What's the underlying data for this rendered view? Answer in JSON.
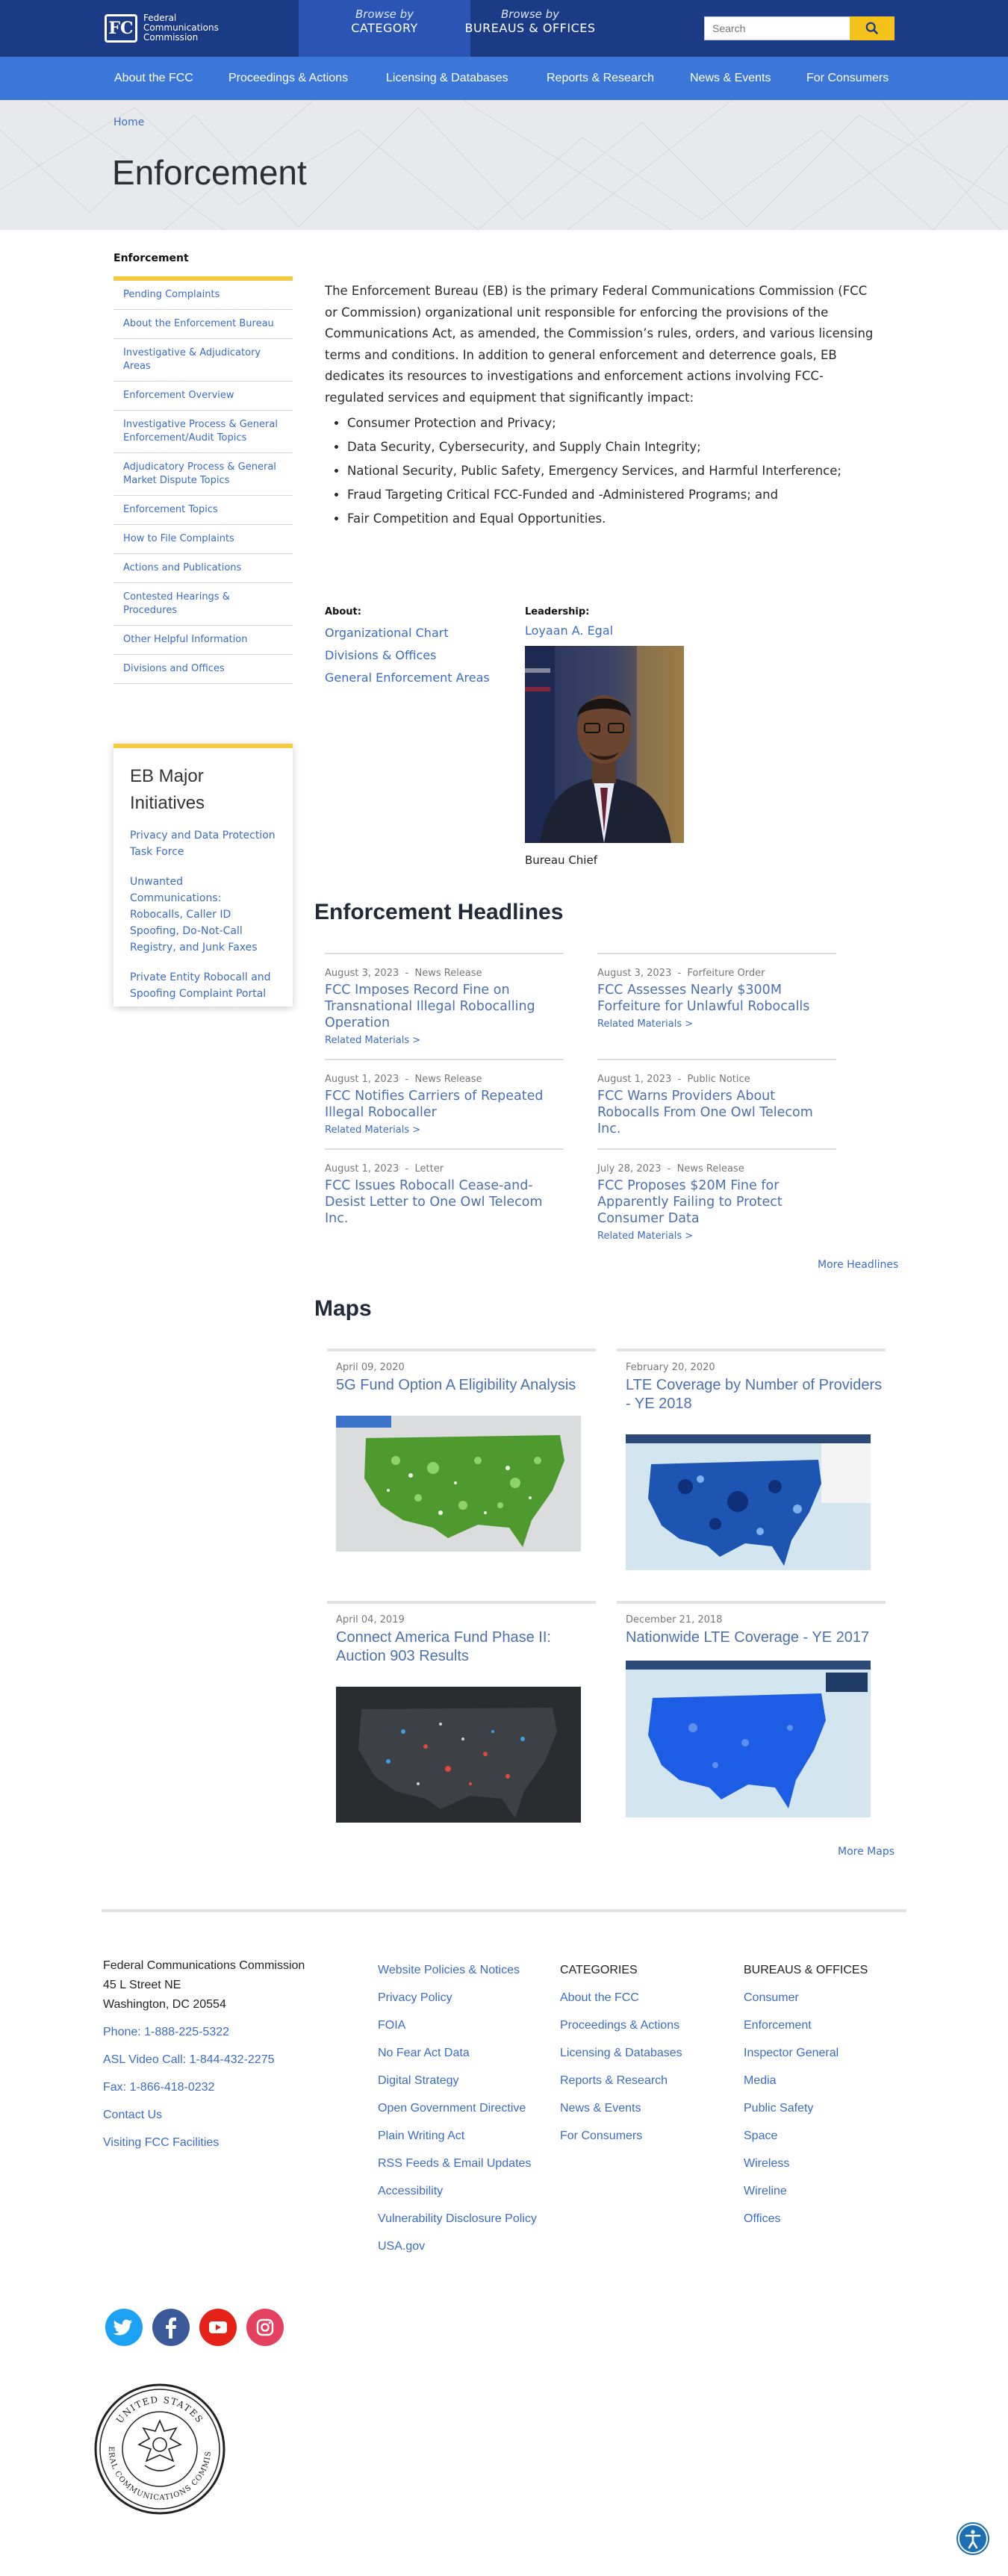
{
  "header": {
    "logo_mark": "FC",
    "logo_line1": "Federal",
    "logo_line2": "Communications",
    "logo_line3": "Commission",
    "browse_category_small": "Browse by",
    "browse_category_large": "CATEGORY",
    "browse_bureaus_small": "Browse by",
    "browse_bureaus_large": "BUREAUS & OFFICES",
    "search_placeholder": "Search",
    "search_icon": "search-icon"
  },
  "nav": {
    "items": [
      "About the FCC",
      "Proceedings & Actions",
      "Licensing & Databases",
      "Reports & Research",
      "News & Events",
      "For Consumers"
    ]
  },
  "hero": {
    "breadcrumb": "Home",
    "title": "Enforcement"
  },
  "sidebar": {
    "heading": "Enforcement",
    "items": [
      "Pending Complaints",
      "About the Enforcement Bureau",
      "Investigative & Adjudicatory Areas",
      "Enforcement Overview",
      "Investigative Process & General Enforcement/Audit Topics",
      "Adjudicatory Process & General Market Dispute Topics",
      "Enforcement Topics",
      "How to File Complaints",
      "Actions and Publications",
      "Contested Hearings & Procedures",
      "Other Helpful Information",
      "Divisions and Offices"
    ],
    "initiatives_title": "EB Major Initiatives",
    "initiatives": [
      "Privacy and Data Protection Task Force",
      "Unwanted Communications: Robocalls, Caller ID Spoofing, Do-Not-Call Registry, and Junk Faxes",
      "Private Entity Robocall and Spoofing Complaint Portal"
    ]
  },
  "intro": {
    "paragraph": "The Enforcement Bureau (EB) is the primary Federal Communications Commission (FCC or Commission) organizational unit responsible for enforcing the provisions of the Communications Act, as amended, the Commission’s rules, orders, and various licensing terms and conditions.  In addition to general enforcement and deterrence goals, EB dedicates its resources to investigations and enforcement actions involving FCC-regulated services and equipment that significantly impact:",
    "bullets": [
      "Consumer Protection and Privacy;",
      "Data Security, Cybersecurity, and Supply Chain Integrity;",
      "National Security, Public Safety, Emergency Services, and Harmful Interference;",
      "Fraud Targeting Critical FCC-Funded and -Administered Programs; and",
      "Fair Competition and Equal Opportunities."
    ]
  },
  "about": {
    "label": "About:",
    "links": [
      "Organizational Chart",
      "Divisions & Offices",
      "General Enforcement Areas"
    ]
  },
  "leadership": {
    "label": "Leadership:",
    "name": "Loyaan A. Egal",
    "caption": "Bureau Chief"
  },
  "headlines": {
    "title": "Enforcement Headlines",
    "related": "Related Materials >",
    "more": "More Headlines",
    "items": [
      {
        "date": "August 3, 2023",
        "type": "News Release",
        "title": "FCC Imposes Record Fine on Transnational Illegal Robocalling Operation",
        "related": true
      },
      {
        "date": "August 3, 2023",
        "type": "Forfeiture Order",
        "title": "FCC Assesses Nearly $300M Forfeiture for Unlawful Robocalls",
        "related": true
      },
      {
        "date": "August 1, 2023",
        "type": "News Release",
        "title": "FCC Notifies Carriers of Repeated Illegal Robocaller",
        "related": true
      },
      {
        "date": "August 1, 2023",
        "type": "Public Notice",
        "title": "FCC Warns Providers About Robocalls From One Owl Telecom Inc.",
        "related": false
      },
      {
        "date": "August 1, 2023",
        "type": "Letter",
        "title": "FCC Issues Robocall Cease-and-Desist Letter to One Owl Telecom Inc.",
        "related": false
      },
      {
        "date": "July 28, 2023",
        "type": "News Release",
        "title": "FCC Proposes $20M Fine for Apparently Failing to Protect Consumer Data",
        "related": true
      }
    ]
  },
  "maps": {
    "title": "Maps",
    "more": "More Maps",
    "items": [
      {
        "date": "April 09, 2020",
        "title": "5G Fund Option A Eligibility Analysis",
        "style": "green"
      },
      {
        "date": "February 20, 2020",
        "title": "LTE Coverage by Number of Providers - YE 2018",
        "style": "blue-heat"
      },
      {
        "date": "April 04, 2019",
        "title": "Connect America Fund Phase II: Auction 903 Results",
        "style": "dark"
      },
      {
        "date": "December 21, 2018",
        "title": "Nationwide LTE Coverage - YE 2017",
        "style": "blue"
      }
    ]
  },
  "footer": {
    "address": [
      "Federal Communications Commission",
      "45 L Street NE",
      "Washington, DC 20554"
    ],
    "contact": [
      "Phone: 1-888-225-5322",
      "ASL Video Call: 1-844-432-2275",
      "Fax: 1-866-418-0232",
      "Contact Us",
      "Visiting FCC Facilities"
    ],
    "policies": [
      "Website Policies & Notices",
      "Privacy Policy",
      "FOIA",
      "No Fear Act Data",
      "Digital Strategy",
      "Open Government Directive",
      "Plain Writing Act",
      "RSS Feeds & Email Updates",
      "Accessibility",
      "Vulnerability Disclosure Policy",
      "USA.gov"
    ],
    "categories_heading": "CATEGORIES",
    "categories": [
      "About the FCC",
      "Proceedings & Actions",
      "Licensing & Databases",
      "Reports & Research",
      "News & Events",
      "For Consumers"
    ],
    "bureaus_heading": "BUREAUS & OFFICES",
    "bureaus": [
      "Consumer",
      "Enforcement",
      "Inspector General",
      "Media",
      "Public Safety",
      "Space",
      "Wireless",
      "Wireline",
      "Offices"
    ],
    "social": [
      {
        "name": "twitter-icon",
        "color": "#1da1f2"
      },
      {
        "name": "facebook-icon",
        "color": "#3b5998"
      },
      {
        "name": "youtube-icon",
        "color": "#e62117"
      },
      {
        "name": "instagram-icon",
        "color": "#e4405f"
      }
    ],
    "seal_top": "UNITED STATES",
    "seal_bottom": "FEDERAL COMMUNICATIONS COMMISSION"
  },
  "colors": {
    "topbar": "#1c3b86",
    "navbar": "#3b76d9",
    "accent_yellow": "#f6c945",
    "link": "#3a6cc4"
  }
}
